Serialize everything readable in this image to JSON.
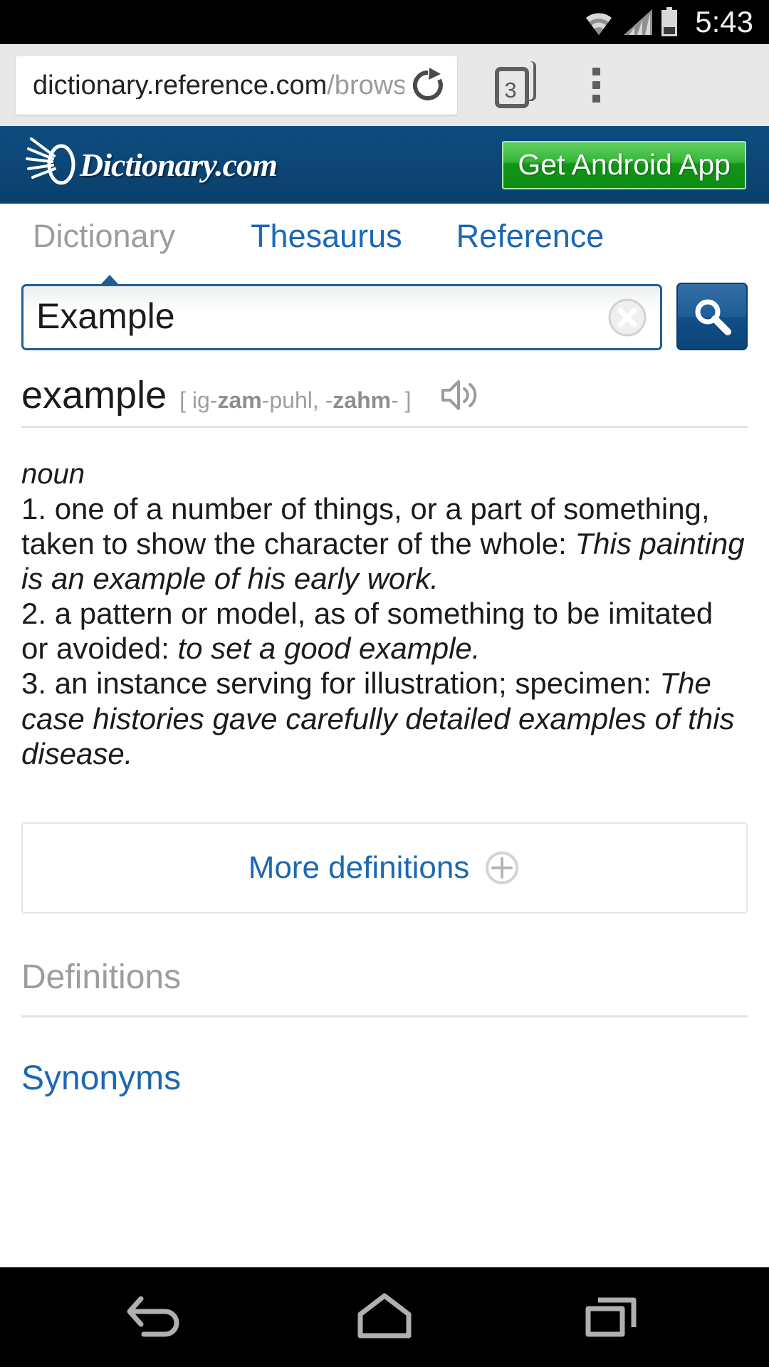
{
  "status_bar": {
    "time": "5:43",
    "icons": [
      "wifi-icon",
      "signal-icon",
      "battery-icon"
    ]
  },
  "browser": {
    "url_domain": "dictionary.reference.com",
    "url_path": "/brows",
    "url_full": "dictionary.reference.com/brows",
    "reload_icon": "reload-icon",
    "tab_count": "3",
    "menu_icon": "overflow-menu-icon"
  },
  "site_header": {
    "brand": "Dictionary.com",
    "brand_icon": "dictionary-sunburst-logo",
    "cta_label": "Get Android App",
    "background_color": "#0b4371",
    "cta_color": "#169a1c"
  },
  "nav_tabs": [
    {
      "label": "Dictionary",
      "active": true
    },
    {
      "label": "Thesaurus",
      "active": false
    },
    {
      "label": "Reference",
      "active": false
    }
  ],
  "search": {
    "value": "Example",
    "placeholder": "",
    "clear_icon": "clear-circle-icon",
    "submit_icon": "search-magnifier-icon",
    "border_color": "#225f92"
  },
  "entry": {
    "headword": "example",
    "pronunciation_prefix": "[ ig-",
    "pronunciation_stress1": "zam",
    "pronunciation_mid": "-puhl, -",
    "pronunciation_stress2": "zahm",
    "pronunciation_suffix": "- ]",
    "pronunciation_full": "[ ig-zam-puhl, -zahm- ]",
    "audio_icon": "speaker-icon",
    "part_of_speech": "noun",
    "definitions": [
      {
        "number": "1.",
        "text": "one of a number of things, or a part of something, taken to show the character of the whole:",
        "example": "This painting is an example of his early work."
      },
      {
        "number": "2.",
        "text": "a pattern or model, as of something to be imitated or avoided:",
        "example": "to set a good example."
      },
      {
        "number": "3.",
        "text": "an instance serving for illustration; specimen:",
        "example": "The case histories gave carefully detailed examples of this disease."
      }
    ]
  },
  "more_definitions": {
    "label": "More definitions",
    "icon": "plus-circle-icon"
  },
  "sections": [
    {
      "label": "Definitions",
      "style": "muted"
    },
    {
      "label": "Synonyms",
      "style": "link"
    }
  ],
  "nav_bar": {
    "back_icon": "back-arrow-icon",
    "home_icon": "home-icon",
    "recents_icon": "recent-apps-icon"
  },
  "colors": {
    "brand_blue": "#0b4371",
    "link_blue": "#1b68b3",
    "green": "#169a1c",
    "muted_gray": "#9d9d9d"
  }
}
